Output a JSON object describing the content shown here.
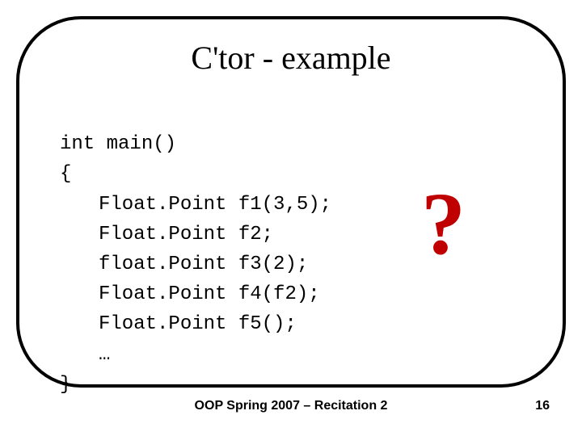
{
  "title": "C'tor - example",
  "code": {
    "l0": "int main()",
    "l1": "{",
    "l2": "Float.Point f1(3,5);",
    "l3": "Float.Point f2;",
    "l4": "float.Point f3(2);",
    "l5": "Float.Point f4(f2);",
    "l6": "Float.Point f5();",
    "l7": "…",
    "l8": "}"
  },
  "qmark": "?",
  "footer": {
    "center": "OOP Spring 2007 – Recitation 2",
    "page": "16"
  }
}
